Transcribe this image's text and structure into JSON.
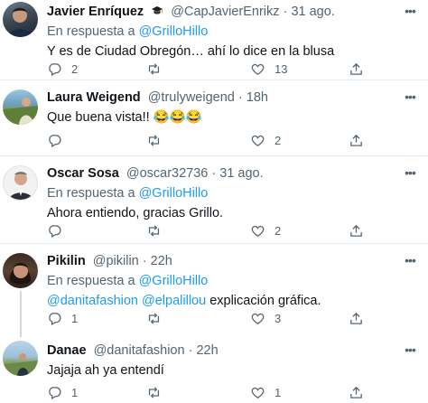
{
  "tweets": [
    {
      "name": "Javier Enríquez",
      "badge": "graduation-cap-emoji",
      "handle": "@CapJavierEnrikz",
      "time": "31 ago.",
      "reply_label": "En respuesta a",
      "reply_to": "@GrilloHillo",
      "text": "Y es de Ciudad Obregón… ahí lo dice en la blusa",
      "replies": "2",
      "retweets": "",
      "likes": "13"
    },
    {
      "name": "Laura Weigend",
      "handle": "@trulyweigend",
      "time": "18h",
      "text": "Que buena vista!! 😂😂😂",
      "replies": "",
      "retweets": "",
      "likes": "2"
    },
    {
      "name": "Oscar Sosa",
      "handle": "@oscar32736",
      "time": "31 ago.",
      "reply_label": "En respuesta a",
      "reply_to": "@GrilloHillo",
      "text": "Ahora entiendo, gracias Grillo.",
      "replies": "",
      "retweets": "",
      "likes": "2"
    },
    {
      "name": "Pikilin",
      "handle": "@pikilin",
      "time": "22h",
      "reply_label": "En respuesta a",
      "reply_to": "@GrilloHillo",
      "mention1": "@danitafashion",
      "mention2": "@elpalillou",
      "text": "explicación gráfica.",
      "replies": "1",
      "retweets": "",
      "likes": "3"
    },
    {
      "name": "Danae",
      "handle": "@danitafashion",
      "time": "22h",
      "text": "Jajaja ah ya entendí",
      "replies": "1",
      "retweets": "",
      "likes": "1"
    }
  ],
  "separator": "·",
  "icons": {
    "reply": "reply-icon",
    "retweet": "retweet-icon",
    "like": "like-icon",
    "share": "share-icon",
    "more": "more-icon"
  },
  "colors": {
    "accent": "#1d9bf0",
    "secondary_text": "#536471",
    "border": "#e6ecf0"
  }
}
